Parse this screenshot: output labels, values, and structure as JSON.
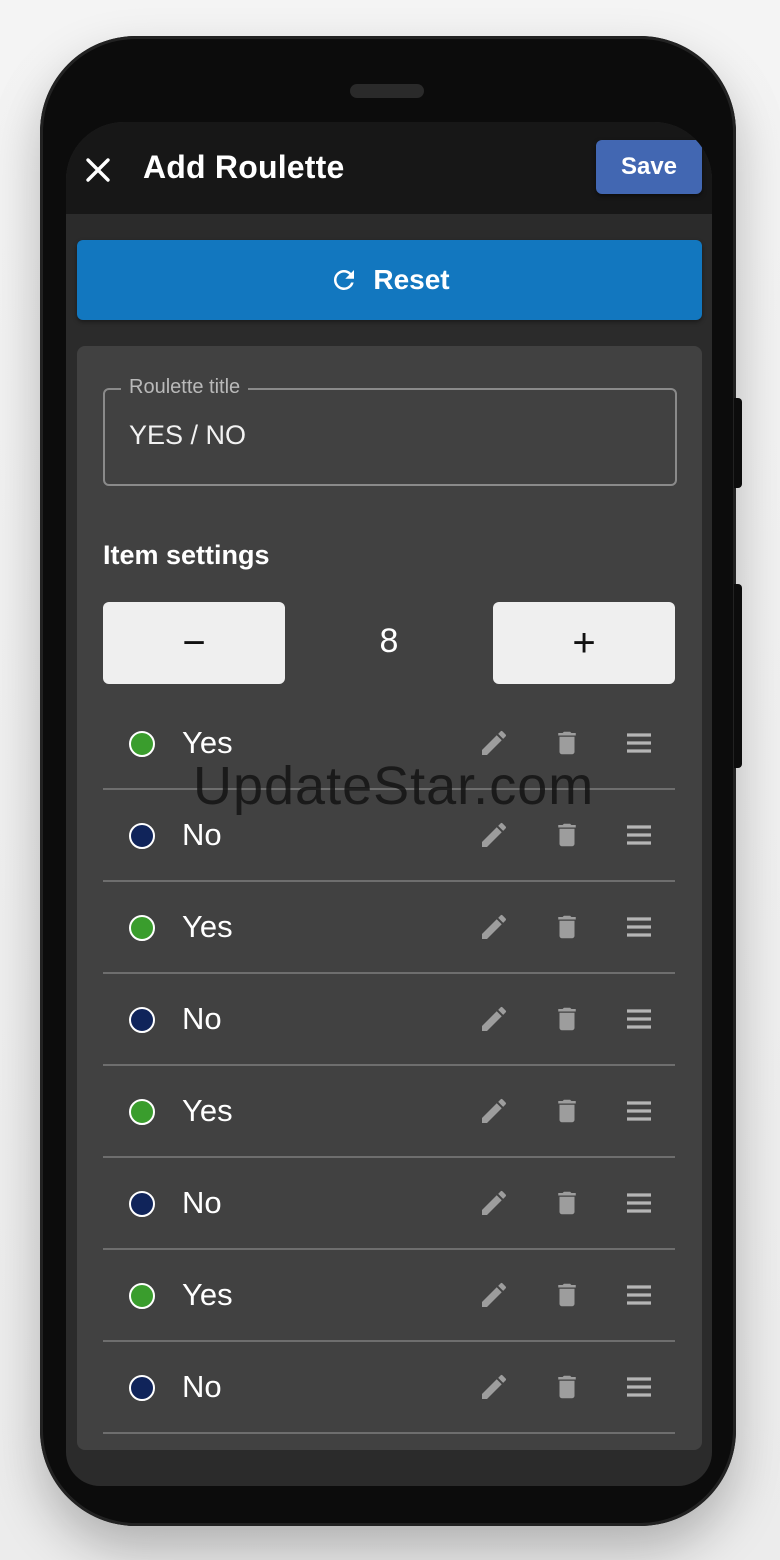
{
  "appbar": {
    "title": "Add Roulette",
    "save_label": "Save",
    "close_icon": "close-icon"
  },
  "reset": {
    "label": "Reset",
    "icon": "refresh-icon"
  },
  "title_field": {
    "label": "Roulette title",
    "value": "YES / NO"
  },
  "items_section": {
    "title": "Item settings",
    "count": "8",
    "minus_label": "−",
    "plus_label": "+"
  },
  "items": [
    {
      "label": "Yes",
      "color": "#3a9d2d"
    },
    {
      "label": "No",
      "color": "#10245a"
    },
    {
      "label": "Yes",
      "color": "#3a9d2d"
    },
    {
      "label": "No",
      "color": "#10245a"
    },
    {
      "label": "Yes",
      "color": "#3a9d2d"
    },
    {
      "label": "No",
      "color": "#10245a"
    },
    {
      "label": "Yes",
      "color": "#3a9d2d"
    },
    {
      "label": "No",
      "color": "#10245a"
    }
  ],
  "watermark": "UpdateStar.com",
  "colors": {
    "accent": "#1277bf",
    "save": "#4267b2",
    "surface": "#414141",
    "appbar": "#171717"
  }
}
